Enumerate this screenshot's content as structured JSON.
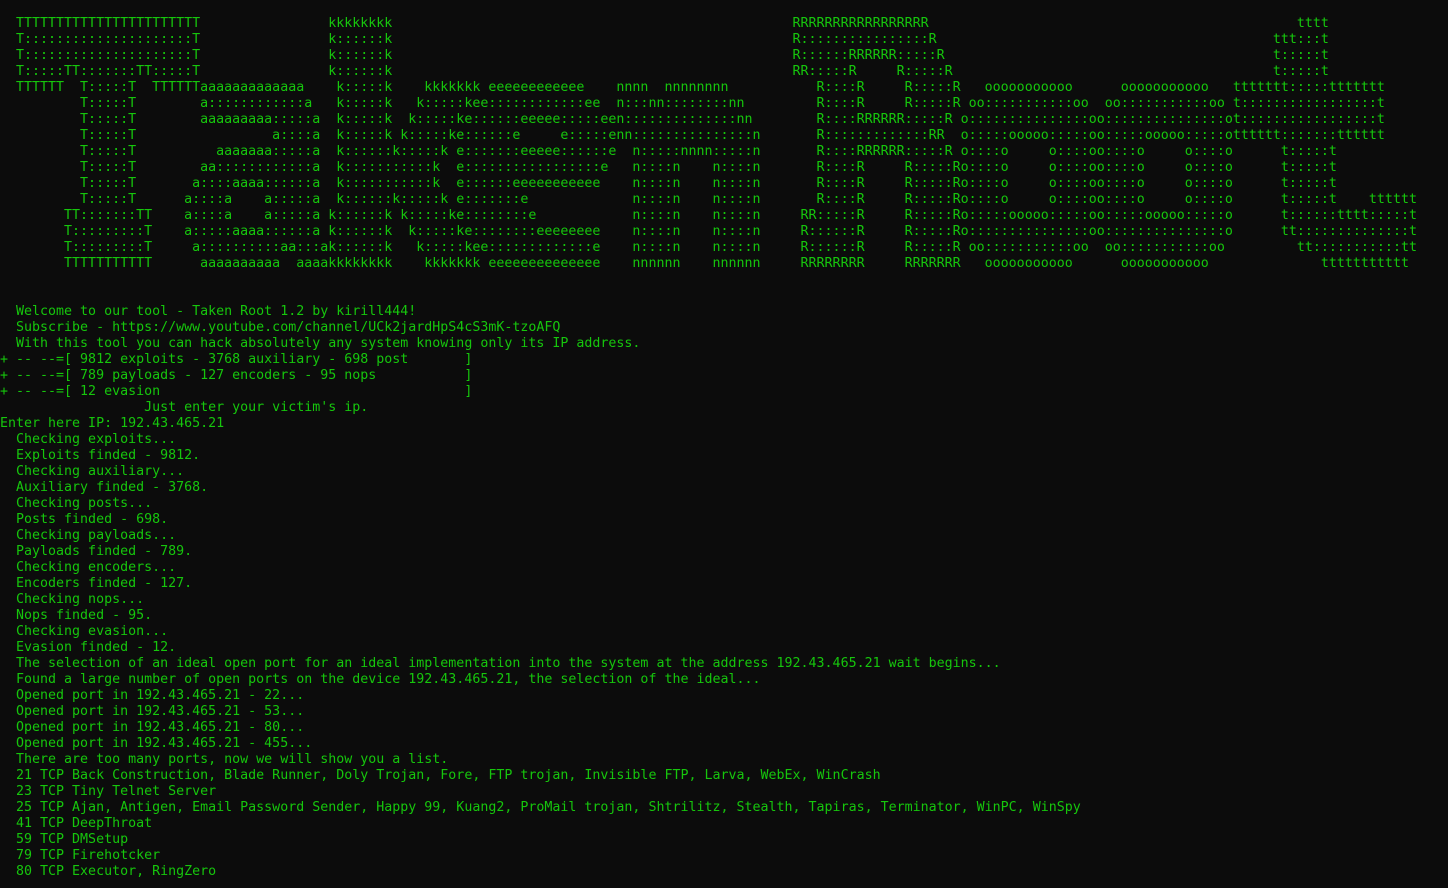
{
  "terminal": {
    "text_color": "#16c60c",
    "background_color": "#0c0c0c",
    "banner": [
      "  TTTTTTTTTTTTTTTTTTTTTTT                kkkkkkkk                                                  RRRRRRRRRRRRRRRRR                                              tttt",
      "  T:::::::::::::::::::::T                k::::::k                                                  R::::::::::::::::R                                          ttt:::t",
      "  T:::::::::::::::::::::T                k::::::k                                                  R::::::RRRRRR:::::R                                         t:::::t",
      "  T:::::TT:::::::TT:::::T                k::::::k                                                  RR:::::R     R:::::R                                        t:::::t",
      "  TTTTTT  T:::::T  TTTTTTaaaaaaaaaaaaa    k:::::k    kkkkkkk eeeeeeeeeeee    nnnn  nnnnnnnn           R::::R     R:::::R   ooooooooooo      ooooooooooo   ttttttt:::::ttttttt",
      "          T:::::T        a::::::::::::a   k:::::k   k:::::kee::::::::::::ee  n:::nn::::::::nn         R::::R     R:::::R oo:::::::::::oo  oo:::::::::::oo t:::::::::::::::::t",
      "          T:::::T        aaaaaaaaa:::::a  k:::::k  k:::::ke::::::eeeee:::::een::::::::::::::nn        R::::RRRRRR:::::R o:::::::::::::::oo:::::::::::::::ot:::::::::::::::::t",
      "          T:::::T                 a::::a  k:::::k k:::::ke::::::e     e:::::enn:::::::::::::::n       R:::::::::::::RR  o:::::ooooo:::::oo:::::ooooo:::::otttttt:::::::tttttt",
      "          T:::::T          aaaaaaa:::::a  k::::::k:::::k e:::::::eeeee::::::e  n:::::nnnn:::::n       R::::RRRRRR:::::R o::::o     o::::oo::::o     o::::o      t:::::t",
      "          T:::::T        aa::::::::::::a  k:::::::::::k  e:::::::::::::::::e   n::::n    n::::n       R::::R     R:::::Ro::::o     o::::oo::::o     o::::o      t:::::t",
      "          T:::::T       a::::aaaa::::::a  k:::::::::::k  e::::::eeeeeeeeeee    n::::n    n::::n       R::::R     R:::::Ro::::o     o::::oo::::o     o::::o      t:::::t",
      "          T:::::T      a::::a    a:::::a  k::::::k:::::k e:::::::e             n::::n    n::::n       R::::R     R:::::Ro::::o     o::::oo::::o     o::::o      t:::::t    tttttt",
      "        TT:::::::TT    a::::a    a:::::a k::::::k k:::::ke::::::::e            n::::n    n::::n     RR:::::R     R:::::Ro:::::ooooo:::::oo:::::ooooo:::::o      t::::::tttt:::::t",
      "        T:::::::::T    a:::::aaaa::::::a k::::::k  k:::::ke::::::::eeeeeeee    n::::n    n::::n     R::::::R     R:::::Ro:::::::::::::::oo:::::::::::::::o      tt::::::::::::::t",
      "        T:::::::::T     a::::::::::aa:::ak::::::k   k:::::kee:::::::::::::e    n::::n    n::::n     R::::::R     R:::::R oo:::::::::::oo  oo:::::::::::oo         tt:::::::::::tt",
      "        TTTTTTTTTTT      aaaaaaaaaa  aaaakkkkkkkk    kkkkkkk eeeeeeeeeeeeee    nnnnnn    nnnnnn     RRRRRRRR     RRRRRRR   ooooooooooo      ooooooooooo              ttttttttttt"
    ],
    "output": [
      "  Welcome to our tool - Taken Root 1.2 by kirill444!",
      "  Subscribe - https://www.youtube.com/channel/UCk2jardHpS4cS3mK-tzoAFQ",
      "  With this tool you can hack absolutely any system knowing only its IP address.",
      "+ -- --=[ 9812 exploits - 3768 auxiliary - 698 post       ]",
      "+ -- --=[ 789 payloads - 127 encoders - 95 nops           ]",
      "+ -- --=[ 12 evasion                                      ]",
      "                  Just enter your victim's ip.",
      "Enter here IP: 192.43.465.21",
      "  Checking exploits...",
      "  Exploits finded - 9812.",
      "  Checking auxiliary...",
      "  Auxiliary finded - 3768.",
      "  Checking posts...",
      "  Posts finded - 698.",
      "  Checking payloads...",
      "  Payloads finded - 789.",
      "  Checking encoders...",
      "  Encoders finded - 127.",
      "  Checking nops...",
      "  Nops finded - 95.",
      "  Checking evasion...",
      "  Evasion finded - 12.",
      "  The selection of an ideal open port for an ideal implementation into the system at the address 192.43.465.21 wait begins...",
      "  Found a large number of open ports on the device 192.43.465.21, the selection of the ideal...",
      "  Opened port in 192.43.465.21 - 22...",
      "  Opened port in 192.43.465.21 - 53...",
      "  Opened port in 192.43.465.21 - 80...",
      "  Opened port in 192.43.465.21 - 455...",
      "  There are too many ports, now we will show you a list.",
      "  21 TCP Back Construction, Blade Runner, Doly Trojan, Fore, FTP trojan, Invisible FTP, Larva, WebEx, WinCrash",
      "  23 TCP Tiny Telnet Server",
      "  25 TCP Ajan, Antigen, Email Password Sender, Happy 99, Kuang2, ProMail trojan, Shtrilitz, Stealth, Tapiras, Terminator, WinPC, WinSpy",
      "  41 TCP DeepThroat",
      "  59 TCP DMSetup",
      "  79 TCP Firehotcker",
      "  80 TCP Executor, RingZero"
    ]
  }
}
